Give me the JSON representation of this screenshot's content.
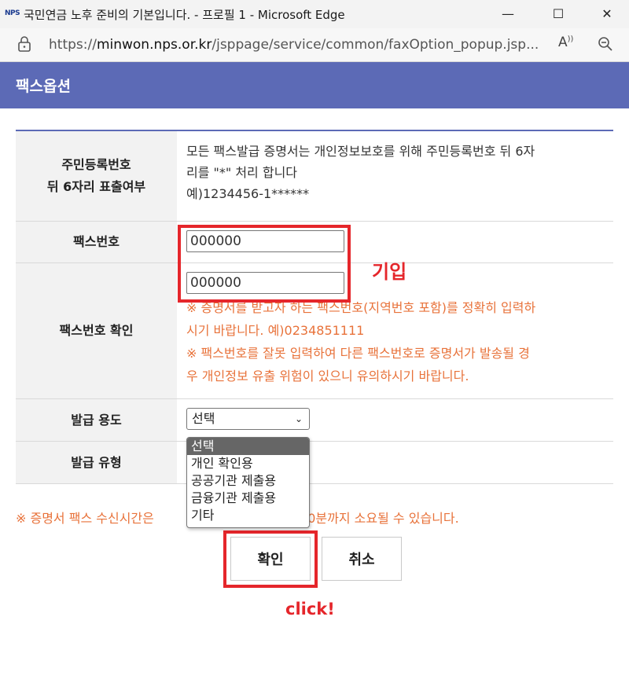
{
  "window": {
    "favicon_text": "NPS",
    "title": "국민연금 노후 준비의 기본입니다. - 프로필 1 - Microsoft Edge",
    "minimize": "—",
    "maximize": "☐",
    "close": "✕"
  },
  "address": {
    "url_prefix": "https://",
    "url_domain": "minwon.nps.or.kr",
    "url_path": "/jsppage/service/common/faxOption_popup.jsp...",
    "read_aloud": "A"
  },
  "header": {
    "title": "팩스옵션"
  },
  "rows": {
    "ssn": {
      "label_line1": "주민등록번호",
      "label_line2": "뒤 6자리 표출여부",
      "desc_line1": "모든 팩스발급 증명서는 개인정보보호를 위해 주민등록번호 뒤 6자",
      "desc_line2": "리를 \"*\" 처리 합니다",
      "desc_line3": "예)1234456-1******"
    },
    "fax_number": {
      "label": "팩스번호",
      "value": "000000"
    },
    "fax_confirm": {
      "label": "팩스번호 확인",
      "value": "000000",
      "note1_line1": "※ 증명서를 받고자 하는 팩스번호(지역번호 포함)를 정확히 입력하",
      "note1_line2": "시기 바랍니다. 예)0234851111",
      "note2_line1": "※ 팩스번호를 잘못 입력하여 다른 팩스번호로 증명서가 발송될 경",
      "note2_line2": "우 개인정보 유출 위험이 있으니 유의하시기 바랍니다."
    },
    "purpose": {
      "label": "발급 용도",
      "selected": "선택",
      "options": [
        "선택",
        "개인 확인용",
        "공공기관 제출용",
        "금융기관 제출용",
        "기타"
      ]
    },
    "type": {
      "label": "발급 유형"
    }
  },
  "bottom_note_left": "※ 증명서 팩스 수신시간은 ",
  "bottom_note_right": "최장 5~10분까지 소요될 수 있습니다.",
  "buttons": {
    "confirm": "확인",
    "cancel": "취소"
  },
  "annotations": {
    "enter": "기입",
    "click": "click!"
  },
  "colors": {
    "header": "#5c6ab6",
    "note": "#e8723a",
    "annotation": "#e5262b"
  }
}
